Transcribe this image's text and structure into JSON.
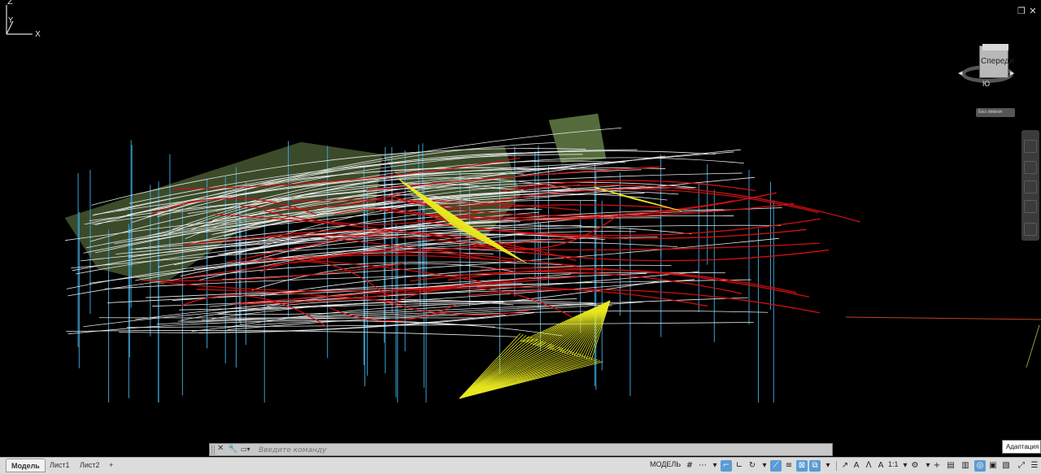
{
  "window": {
    "restore_icon": "restore-icon",
    "close_icon": "close-icon"
  },
  "viewcube": {
    "face": "Спереди",
    "south": "Ю",
    "ucs_menu": "Без имени"
  },
  "ucs": {
    "x": "X",
    "y": "Y",
    "z": "Z"
  },
  "command_line": {
    "placeholder": "Введите команду"
  },
  "tabs": [
    {
      "label": "Модель",
      "active": true
    },
    {
      "label": "Лист1",
      "active": false
    },
    {
      "label": "Лист2",
      "active": false
    }
  ],
  "add_tab": "+",
  "status": {
    "mode": "МОДЕЛЬ",
    "scale": "1:1"
  },
  "tooltip": "Адаптация",
  "colors": {
    "background": "#000000",
    "white_lines": "#e8e8e8",
    "red_lines": "#d01010",
    "green_surface": "#a8d878",
    "yellow_lines": "#e8e820",
    "blue_lines": "#3aa0d0"
  }
}
